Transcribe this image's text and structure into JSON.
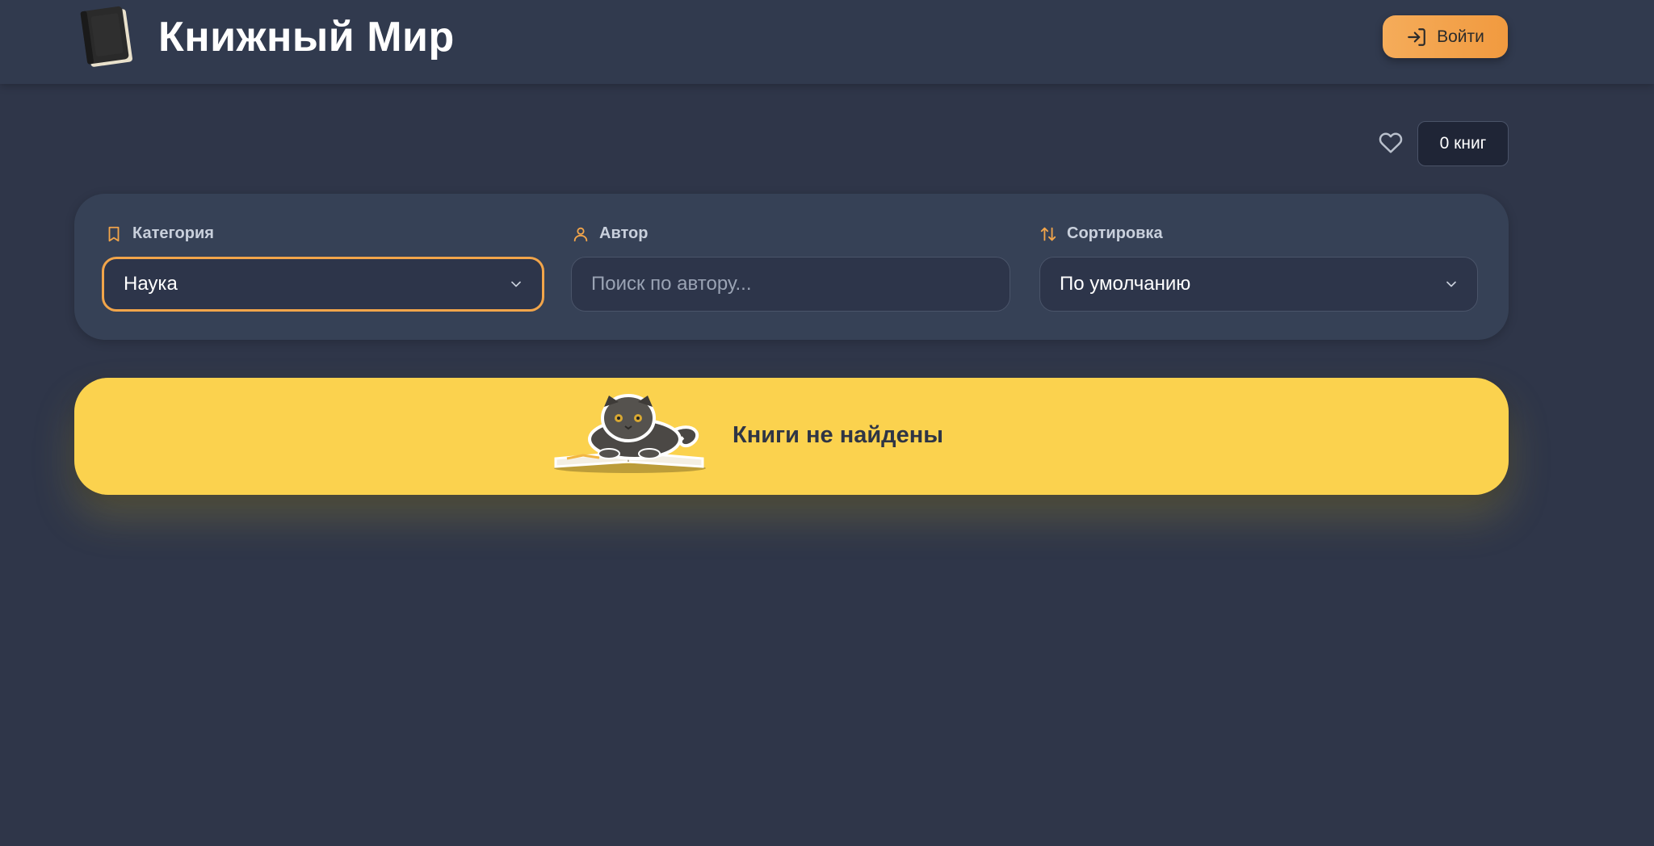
{
  "header": {
    "brand_title": "Книжный Мир",
    "login_label": "Войти"
  },
  "favorites": {
    "count_label": "0 книг"
  },
  "filters": {
    "category": {
      "label": "Категория",
      "selected": "Наука"
    },
    "author": {
      "label": "Автор",
      "value": "",
      "placeholder": "Поиск по автору..."
    },
    "sort": {
      "label": "Сортировка",
      "selected": "По умолчанию"
    }
  },
  "results": {
    "empty_message": "Книги не найдены"
  },
  "colors": {
    "accent": "#f2a54a",
    "banner": "#fbd24e",
    "background": "#2f3649",
    "panel": "#364156"
  },
  "icons": {
    "logo": "book-icon",
    "login": "login-arrow-icon",
    "favorites": "heart-icon",
    "category": "bookmark-icon",
    "author": "user-icon",
    "sort": "sort-arrows-icon",
    "dropdown": "chevron-down-icon"
  }
}
